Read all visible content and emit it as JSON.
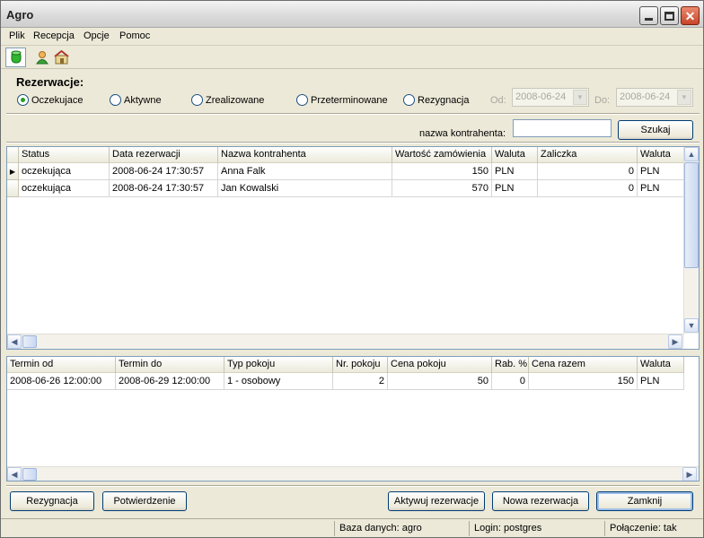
{
  "window": {
    "title": "Agro"
  },
  "menu": [
    "Plik",
    "Recepcja",
    "Opcje",
    "Pomoc"
  ],
  "toolbar": {
    "icons": [
      "database-icon",
      "user-icon",
      "reception-icon"
    ]
  },
  "filter": {
    "title": "Rezerwacje:",
    "options": [
      {
        "label": "Oczekujace",
        "checked": true
      },
      {
        "label": "Aktywne",
        "checked": false
      },
      {
        "label": "Zrealizowane",
        "checked": false
      },
      {
        "label": "Przeterminowane",
        "checked": false
      },
      {
        "label": "Rezygnacja",
        "checked": false
      }
    ],
    "from_label": "Od:",
    "from_value": "2008-06-24",
    "to_label": "Do:",
    "to_value": "2008-06-24",
    "search_label": "nazwa kontrahenta:",
    "search_value": "",
    "search_button": "Szukaj"
  },
  "reservations": {
    "columns": [
      "Status",
      "Data rezerwacji",
      "Nazwa kontrahenta",
      "Wartość zamówienia",
      "Waluta",
      "Zaliczka",
      "Waluta"
    ],
    "rows": [
      [
        "oczekująca",
        "2008-06-24 17:30:57",
        "Anna Falk",
        "150",
        "PLN",
        "0",
        "PLN"
      ],
      [
        "oczekująca",
        "2008-06-24 17:30:57",
        "Jan Kowalski",
        "570",
        "PLN",
        "0",
        "PLN"
      ]
    ]
  },
  "details": {
    "columns": [
      "Termin od",
      "Termin do",
      "Typ pokoju",
      "Nr. pokoju",
      "Cena pokoju",
      "Rab. %",
      "Cena razem",
      "Waluta"
    ],
    "rows": [
      [
        "2008-06-26 12:00:00",
        "2008-06-29 12:00:00",
        "1 - osobowy",
        "2",
        "50",
        "0",
        "150",
        "PLN"
      ]
    ]
  },
  "buttons": {
    "resign": "Rezygnacja",
    "confirm": "Potwierdzenie",
    "activate": "Aktywuj rezerwacje",
    "new": "Nowa rezerwacja",
    "close": "Zamknij"
  },
  "status": {
    "db": "Baza danych: agro",
    "login": "Login: postgres",
    "connection": "Połączenie: tak"
  }
}
